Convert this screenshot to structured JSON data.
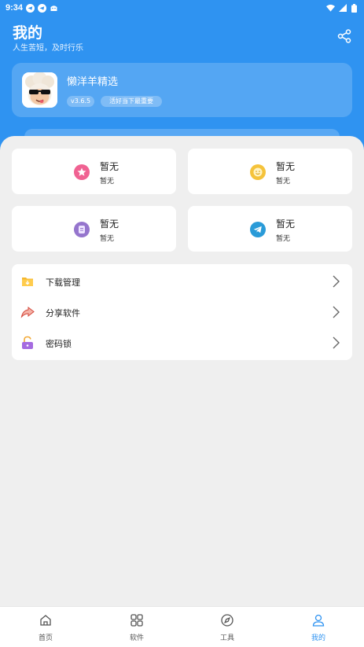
{
  "status_bar": {
    "time": "9:34"
  },
  "header": {
    "title": "我的",
    "subtitle": "人生苦短，及时行乐"
  },
  "app_card": {
    "name": "懒洋羊精选",
    "version": "v3.6.5",
    "slogan": "活好当下最重要"
  },
  "grid_cards": [
    {
      "title": "暂无",
      "subtitle": "暂无",
      "icon": "star-icon",
      "color": "#f06292"
    },
    {
      "title": "暂无",
      "subtitle": "暂无",
      "icon": "smiley-icon",
      "color": "#f5c33b"
    },
    {
      "title": "暂无",
      "subtitle": "暂无",
      "icon": "note-icon",
      "color": "#9575cd"
    },
    {
      "title": "暂无",
      "subtitle": "暂无",
      "icon": "telegram-icon",
      "color": "#2a9bd8"
    }
  ],
  "menu": [
    {
      "label": "下载管理",
      "icon": "download-folder-icon"
    },
    {
      "label": "分享软件",
      "icon": "share-arrow-icon"
    },
    {
      "label": "密码锁",
      "icon": "unlock-icon"
    }
  ],
  "tabs": [
    {
      "label": "首页",
      "icon": "home-icon"
    },
    {
      "label": "软件",
      "icon": "grid-icon"
    },
    {
      "label": "工具",
      "icon": "compass-icon"
    },
    {
      "label": "我的",
      "icon": "user-icon",
      "active": true
    }
  ],
  "colors": {
    "primary": "#2f93f1",
    "background": "#efefef"
  }
}
